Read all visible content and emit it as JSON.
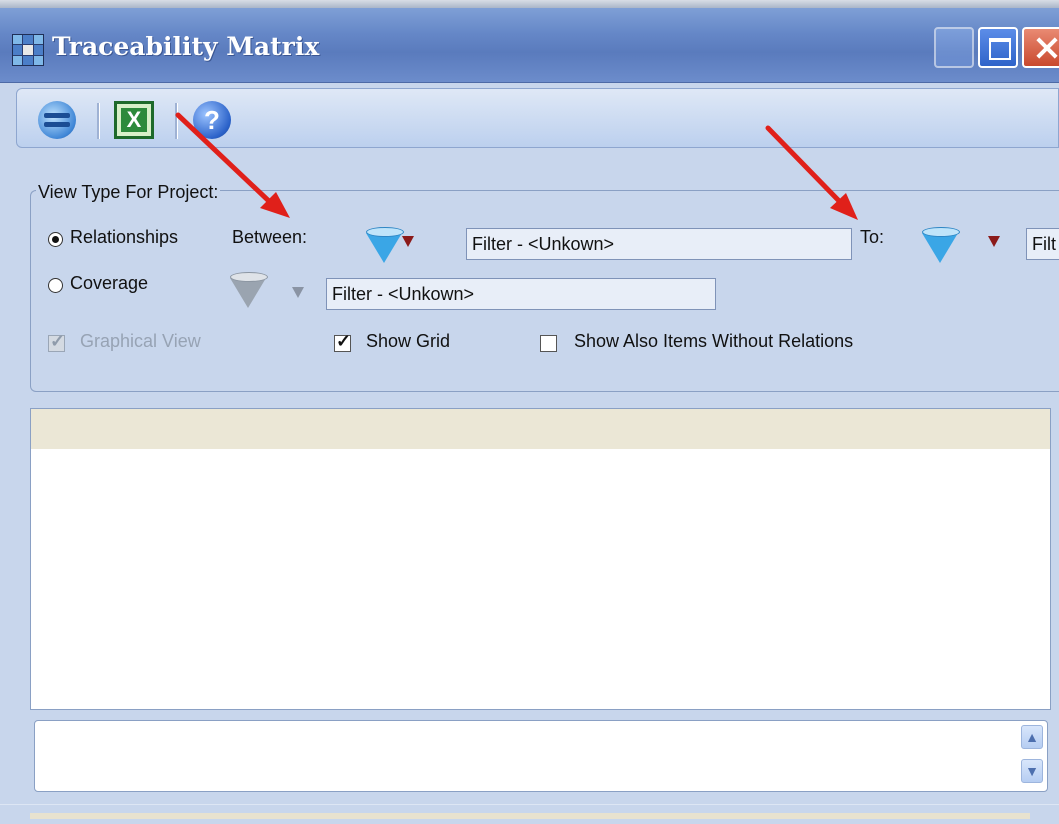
{
  "window": {
    "title": "Traceability Matrix"
  },
  "toolbar": {
    "help_symbol": "?",
    "excel_letter": "X"
  },
  "view_type": {
    "group_label": "View Type For Project:",
    "relationships_label": "Relationships",
    "between_label": "Between:",
    "between_filter": "Filter - <Unkown>",
    "to_label": "To:",
    "to_filter": "Filt",
    "coverage_label": "Coverage",
    "coverage_filter": "Filter - <Unkown>",
    "graphical_view_label": "Graphical View",
    "show_grid_label": "Show Grid",
    "show_without_relations_label": "Show Also Items Without Relations",
    "selected_view": "Relationships",
    "graphical_view_checked": true,
    "show_grid_checked": true,
    "show_without_relations_checked": false
  },
  "colors": {
    "window_bg": "#c8d6ec",
    "title_bar": "#6587c7",
    "annotation_arrow": "#e0201a"
  }
}
